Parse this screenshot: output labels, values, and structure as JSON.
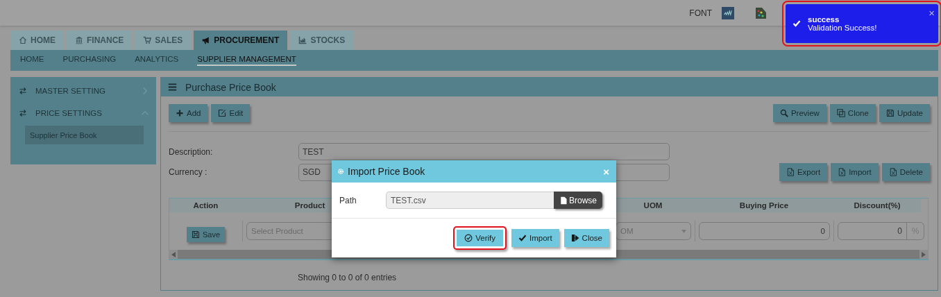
{
  "header": {
    "font_label": "FONT"
  },
  "tabs": [
    {
      "label": "HOME",
      "selected": false
    },
    {
      "label": "FINANCE",
      "selected": false
    },
    {
      "label": "SALES",
      "selected": false
    },
    {
      "label": "PROCUREMENT",
      "selected": true
    },
    {
      "label": "STOCKS",
      "selected": false
    }
  ],
  "subnav": [
    {
      "label": "HOME",
      "selected": false
    },
    {
      "label": "PURCHASING",
      "selected": false
    },
    {
      "label": "ANALYTICS",
      "selected": false
    },
    {
      "label": "SUPPLIER MANAGEMENT",
      "selected": true
    }
  ],
  "sidebar": {
    "items": [
      {
        "label": "MASTER SETTING",
        "expanded": false
      },
      {
        "label": "PRICE SETTINGS",
        "expanded": true,
        "children": [
          {
            "label": "Supplier Price Book",
            "selected": true
          }
        ]
      }
    ]
  },
  "panel": {
    "title": "Purchase Price Book",
    "left_buttons": [
      "Add",
      "Edit"
    ],
    "right_buttons": [
      "Preview",
      "Clone",
      "Update"
    ],
    "form": [
      {
        "label": "Description:",
        "value": "TEST"
      },
      {
        "label": "Currency :",
        "value": "SGD"
      }
    ],
    "file_buttons": [
      "Export",
      "Import",
      "Delete"
    ],
    "table": {
      "columns": [
        "Action",
        "Product",
        "UOM",
        "Buying Price",
        "Discount(%)"
      ],
      "row": {
        "action": "Save",
        "product_placeholder": "Select Product",
        "uom_placeholder": "OM",
        "buying_price": "0",
        "discount": "0",
        "discount_unit": "%"
      }
    },
    "footer": "Showing 0 to 0 of 0 entries"
  },
  "modal": {
    "title": "Import Price Book",
    "close": "×",
    "path_label": "Path",
    "path_value": "TEST.csv",
    "browse": "Browse",
    "buttons": [
      {
        "label": "Verify",
        "highlighted": true
      },
      {
        "label": "Import",
        "highlighted": false
      },
      {
        "label": "Close",
        "highlighted": false
      }
    ]
  },
  "toast": {
    "title": "success",
    "message": "Validation Success!",
    "close": "×",
    "highlighted": true
  }
}
